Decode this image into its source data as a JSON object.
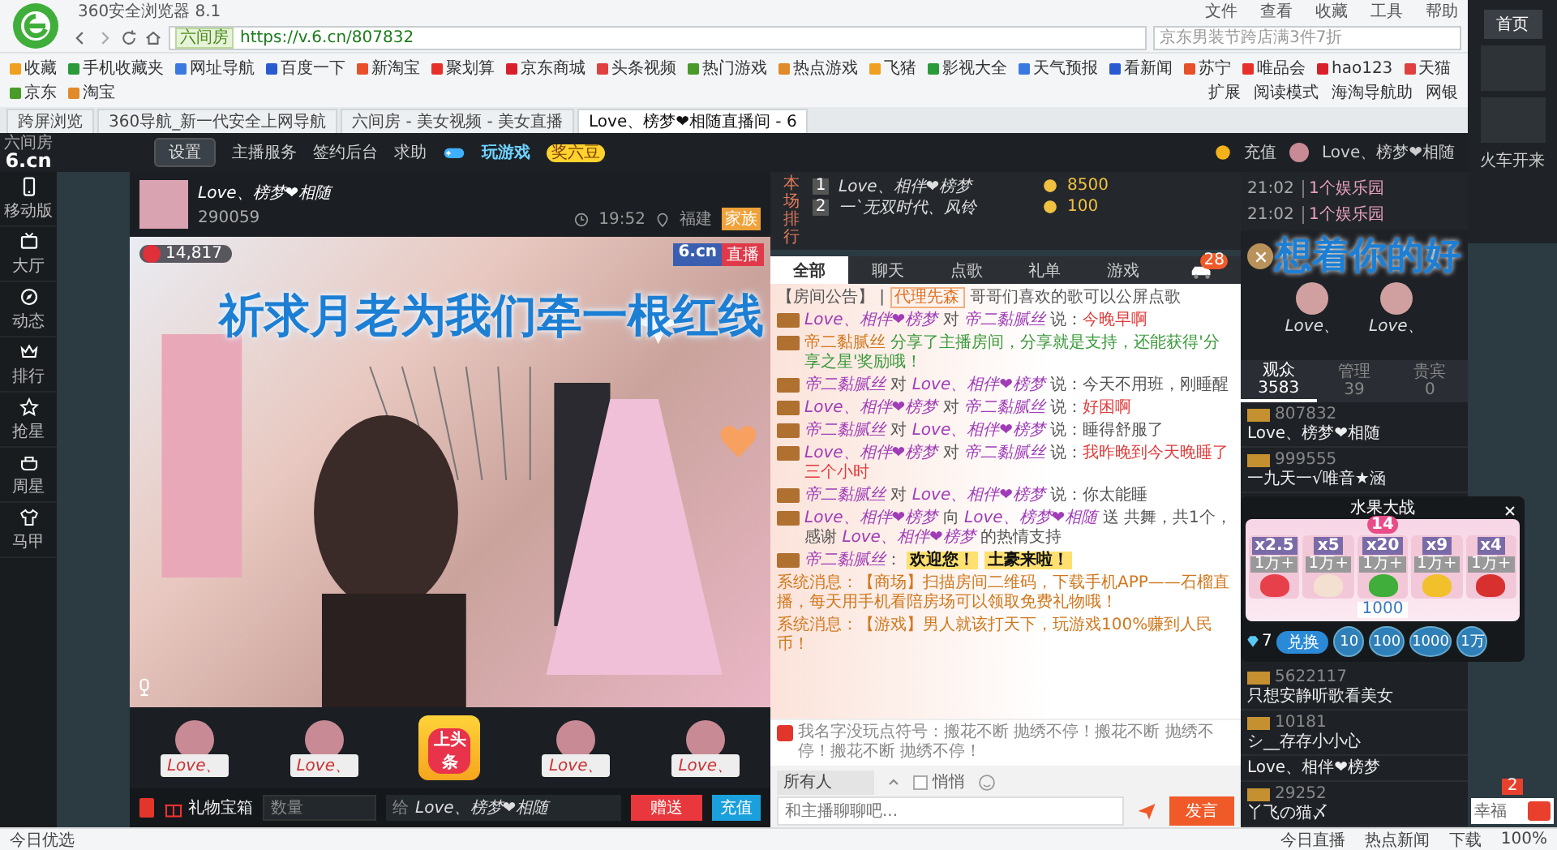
{
  "browser": {
    "title": "360安全浏览器 8.1",
    "menu": [
      "文件",
      "查看",
      "收藏",
      "工具",
      "帮助"
    ],
    "address": {
      "site_badge": "六间房",
      "url": "https://v.6.cn/807832",
      "search_placeholder": "京东男装节跨店满3件7折"
    },
    "bookmarks": [
      "收藏",
      "手机收藏夹",
      "网址导航",
      "百度一下",
      "新淘宝",
      "聚划算",
      "京东商城",
      "头条视频",
      "热门游戏",
      "热点游戏",
      "飞猪",
      "影视大全",
      "天气预报",
      "看新闻",
      "苏宁",
      "唯品会",
      "hao123",
      "天猫",
      "京东",
      "淘宝"
    ],
    "toolbar_right": [
      "扩展",
      "阅读模式",
      "海淘导航助",
      "网银"
    ],
    "tabs": [
      {
        "label": "跨屏浏览",
        "selected": false
      },
      {
        "label": "360导航_新一代安全上网导航",
        "selected": false
      },
      {
        "label": "六间房 - 美女视频 - 美女直播",
        "selected": false
      },
      {
        "label": "Love、榜梦❤相随直播间 - 6",
        "selected": true
      }
    ]
  },
  "site_header": {
    "logo": "6.cn",
    "logo_sub": "六间房",
    "settings": "设置",
    "links": [
      "主播服务",
      "签约后台",
      "求助"
    ],
    "game": "玩游戏",
    "game_badge": "奖六豆",
    "recharge": "充值",
    "user": "Love、榜梦❤相随"
  },
  "sidebar": {
    "items": [
      {
        "label": "移动版"
      },
      {
        "label": "大厅"
      },
      {
        "label": "动态"
      },
      {
        "label": "排行"
      },
      {
        "label": "抢星"
      },
      {
        "label": "周星"
      },
      {
        "label": "马甲"
      }
    ]
  },
  "stream": {
    "anchor": "Love、榜梦❤相随",
    "fans": "290059",
    "time": "19:52",
    "location": "福建",
    "family": "家族",
    "viewers": "14,817",
    "logo": "6.cn",
    "live": "直播"
  },
  "overlay_texts": [
    "祈求月老为我们牵一根红线",
    "想着你的好"
  ],
  "gift_row": {
    "items": [
      {
        "kind": "avatar",
        "label": "Love、"
      },
      {
        "kind": "avatar",
        "label": "Love、"
      },
      {
        "kind": "headline",
        "label": "上头条"
      },
      {
        "kind": "avatar",
        "label": "Love、"
      },
      {
        "kind": "avatar",
        "label": "Love、"
      }
    ]
  },
  "gift_bar": {
    "box": "礼物宝箱",
    "quantity_placeholder": "数量",
    "to": "给",
    "recipient": "Love、榜梦❤相随",
    "send": "赠送",
    "recharge": "充值"
  },
  "notices": [
    {
      "time": "21:02",
      "text": "1个娱乐园"
    },
    {
      "time": "21:02",
      "text": "1个娱乐园"
    }
  ],
  "rank": {
    "title": "本场排行",
    "rows": [
      {
        "rank": "1",
        "name": "Love、相伴❤榜梦",
        "score": "8500"
      },
      {
        "rank": "2",
        "name": "一`无双时代、风铃",
        "score": "100"
      }
    ]
  },
  "chat": {
    "tabs": [
      {
        "label": "全部",
        "selected": true
      },
      {
        "label": "聊天",
        "selected": false
      },
      {
        "label": "点歌",
        "selected": false
      },
      {
        "label": "礼单",
        "selected": false
      },
      {
        "label": "游戏",
        "selected": false
      }
    ],
    "car_badge": "28",
    "messages": [
      {
        "kind": "announce",
        "parts": [
          {
            "kind": "plain",
            "text": "【房间公告】 | "
          },
          {
            "kind": "tag",
            "text": "代理先森"
          },
          {
            "kind": "plain",
            "text": " 哥哥们喜欢的歌可以公屏点歌"
          }
        ]
      },
      {
        "kind": "talk",
        "parts": [
          {
            "kind": "name",
            "text": "Love、相伴❤榜梦"
          },
          {
            "kind": "plain",
            "text": " 对 "
          },
          {
            "kind": "name",
            "text": "帝二黏腻丝"
          },
          {
            "kind": "plain",
            "text": " 说："
          },
          {
            "kind": "content",
            "text": "今晚早啊"
          }
        ]
      },
      {
        "kind": "talk",
        "parts": [
          {
            "kind": "sys",
            "text": "帝二黏腻丝"
          },
          {
            "kind": "share",
            "text": " 分享了主播房间，分享就是支持，还能获得'分享之星'奖励哦！"
          }
        ]
      },
      {
        "kind": "talk",
        "parts": [
          {
            "kind": "name",
            "text": "帝二黏腻丝"
          },
          {
            "kind": "plain",
            "text": " 对 "
          },
          {
            "kind": "name",
            "text": "Love、相伴❤榜梦"
          },
          {
            "kind": "plain",
            "text": " 说：今天不用班，刚睡醒"
          }
        ]
      },
      {
        "kind": "talk",
        "parts": [
          {
            "kind": "name",
            "text": "Love、相伴❤榜梦"
          },
          {
            "kind": "plain",
            "text": " 对 "
          },
          {
            "kind": "name",
            "text": "帝二黏腻丝"
          },
          {
            "kind": "plain",
            "text": " 说："
          },
          {
            "kind": "content",
            "text": "好困啊"
          }
        ]
      },
      {
        "kind": "talk",
        "parts": [
          {
            "kind": "name",
            "text": "帝二黏腻丝"
          },
          {
            "kind": "plain",
            "text": " 对 "
          },
          {
            "kind": "name",
            "text": "Love、相伴❤榜梦"
          },
          {
            "kind": "plain",
            "text": " 说：睡得舒服了"
          }
        ]
      },
      {
        "kind": "talk",
        "parts": [
          {
            "kind": "name",
            "text": "Love、相伴❤榜梦"
          },
          {
            "kind": "plain",
            "text": " 对 "
          },
          {
            "kind": "name",
            "text": "帝二黏腻丝"
          },
          {
            "kind": "plain",
            "text": " 说："
          },
          {
            "kind": "content",
            "text": "我昨晚到今天晚睡了三个小时"
          }
        ]
      },
      {
        "kind": "talk",
        "parts": [
          {
            "kind": "name",
            "text": "帝二黏腻丝"
          },
          {
            "kind": "plain",
            "text": " 对 "
          },
          {
            "kind": "name",
            "text": "Love、相伴❤榜梦"
          },
          {
            "kind": "plain",
            "text": " 说：你太能睡"
          }
        ]
      },
      {
        "kind": "talk",
        "parts": [
          {
            "kind": "name",
            "text": "Love、相伴❤榜梦"
          },
          {
            "kind": "plain",
            "text": " 向 "
          },
          {
            "kind": "name",
            "text": "Love、榜梦❤相随"
          },
          {
            "kind": "plain",
            "text": " 送 共舞，共1个，感谢 "
          },
          {
            "kind": "name",
            "text": "Love、相伴❤榜梦"
          },
          {
            "kind": "plain",
            "text": " 的热情支持"
          }
        ]
      },
      {
        "kind": "talk",
        "parts": [
          {
            "kind": "name",
            "text": "帝二黏腻丝"
          },
          {
            "kind": "plain",
            "text": "： "
          },
          {
            "kind": "gold",
            "text": "欢迎您！"
          },
          {
            "kind": "gold",
            "text": "土豪来啦！"
          }
        ]
      },
      {
        "kind": "system",
        "parts": [
          {
            "kind": "sys",
            "text": "系统消息：【商场】扫描房间二维码，下载手机APP——石榴直播，每天用手机看陪房场可以领取免费礼物哦！"
          }
        ]
      },
      {
        "kind": "system",
        "parts": [
          {
            "kind": "sys",
            "text": "系统消息：【游戏】男人就该打天下，玩游戏100%赚到人民币！"
          }
        ]
      }
    ],
    "scroll_notice": "我名字没玩点符号：搬花不断 抛绣不停！搬花不断 抛绣不停！搬花不断 抛绣不停！",
    "input": {
      "target": "所有人",
      "whisper": {
        "label": "悄悄",
        "checked": false
      },
      "placeholder": "和主播聊聊吧...",
      "send": "发言"
    }
  },
  "effects": {
    "avatars": [
      "Love、",
      "Love、"
    ]
  },
  "audience": {
    "tabs": [
      {
        "label": "观众",
        "count": "3583",
        "selected": true
      },
      {
        "label": "管理",
        "count": "39",
        "selected": false
      },
      {
        "label": "贵宾",
        "count": "0",
        "selected": false
      }
    ],
    "users": [
      {
        "id": "807832",
        "name": "Love、榜梦❤相随"
      },
      {
        "id": "999555",
        "name": "一九天一√唯音★涵"
      },
      {
        "id": "5622117",
        "name": "只想安静听歌看美女"
      },
      {
        "id": "10181",
        "name": "シ__存存小小心"
      },
      {
        "name": "Love、相伴❤榜梦"
      },
      {
        "id": "29252",
        "name": "丫飞の猫〆"
      }
    ]
  },
  "fruit_game": {
    "title": "水果大战",
    "round": "14",
    "pool": "1000",
    "diamonds": "7",
    "exchange": "兑换",
    "bets": [
      {
        "multiplier": "x2.5",
        "amount": "1万+",
        "color": "#e8404a"
      },
      {
        "multiplier": "x5",
        "amount": "1万+",
        "color": "#f4e0d0"
      },
      {
        "multiplier": "x20",
        "amount": "1万+",
        "color": "#3fae3a"
      },
      {
        "multiplier": "x9",
        "amount": "1万+",
        "color": "#f2c02a"
      },
      {
        "multiplier": "x4",
        "amount": "1万+",
        "color": "#d8302e"
      }
    ],
    "chips": [
      "10",
      "100",
      "1000",
      "1万"
    ]
  },
  "side_panel": {
    "home": "首页",
    "label": "火车开来"
  },
  "messenger": {
    "badge": "2",
    "text": "幸福"
  },
  "status_bar": {
    "left": "今日优选",
    "items": [
      "今日直播",
      "热点新闻",
      "下载"
    ],
    "zoom": "100%"
  }
}
